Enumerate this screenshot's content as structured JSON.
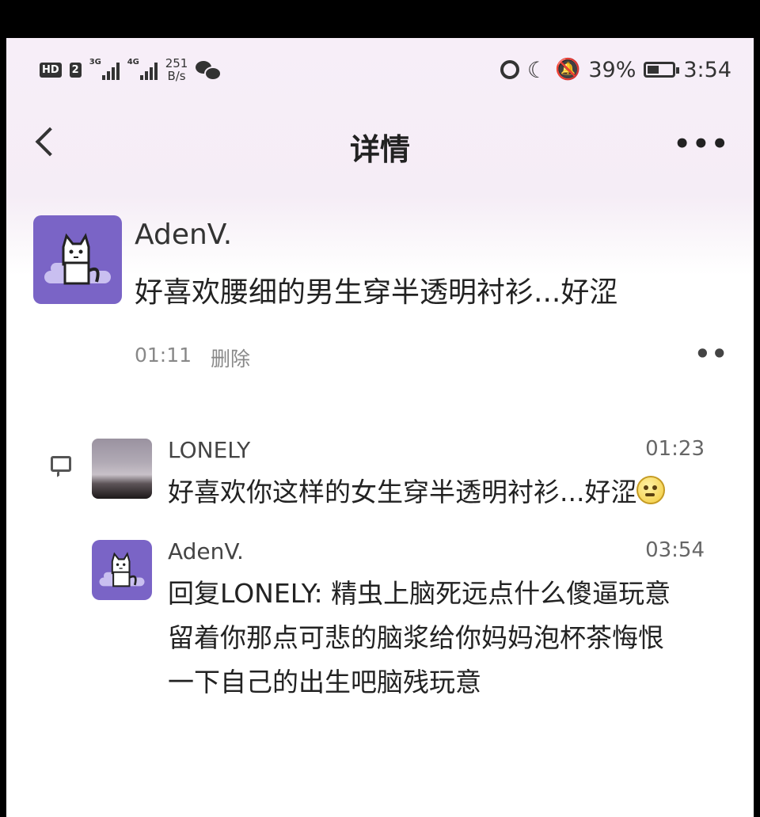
{
  "status_bar": {
    "hd_label": "HD",
    "sim": "2",
    "network1": "3G",
    "network2": "4G",
    "speed_value": "251",
    "speed_unit": "B/s",
    "battery": "39%",
    "battery_level": 0.39,
    "time": "3:54"
  },
  "header": {
    "title": "详情"
  },
  "post": {
    "username": "AdenV.",
    "content": "好喜欢腰细的男生穿半透明衬衫...好涩",
    "time": "01:11",
    "delete_label": "删除",
    "more_label": "••"
  },
  "comments": [
    {
      "username": "LONELY",
      "time": "01:23",
      "text": "好喜欢你这样的女生穿半透明衬衫...好涩"
    },
    {
      "username": "AdenV.",
      "time": "03:54",
      "text": "回复LONELY: 精虫上脑死远点什么傻逼玩意\n留着你那点可悲的脑浆给你妈妈泡杯茶悔恨\n一下自己的出生吧脑残玩意"
    }
  ],
  "colors": {
    "avatar_bg": "#7a64c6",
    "header_bg": "#f7eef8",
    "outer_bg": "#000000"
  }
}
